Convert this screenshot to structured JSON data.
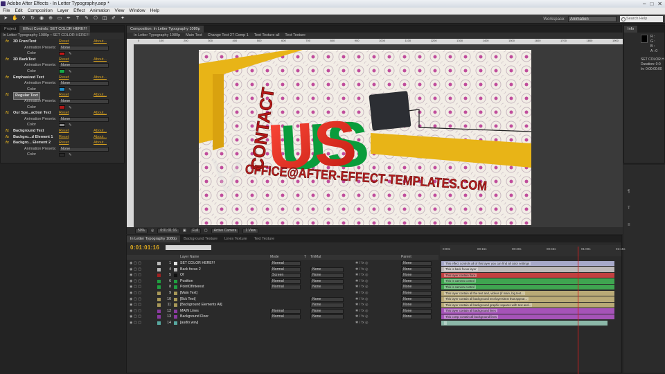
{
  "window": {
    "title": "Adobe After Effects - In Letter Typography.aep *",
    "controls": [
      "–",
      "□",
      "✕"
    ]
  },
  "menu": [
    "File",
    "Edit",
    "Composition",
    "Layer",
    "Effect",
    "Animation",
    "View",
    "Window",
    "Help"
  ],
  "toolbar": {
    "workspace_label": "Workspace:",
    "workspace_value": "Animation",
    "search_placeholder": "Search Help"
  },
  "left_panel": {
    "tabs": [
      "Project",
      "Effect Controls: SET COLOR HERE!!!"
    ],
    "subtitle": "In Letter Typography 1080p • SET COLOR HERE!!!",
    "rows": [
      {
        "kind": "fx",
        "name": "3D FrontText",
        "reset": "Reset",
        "about": "About..."
      },
      {
        "kind": "preset",
        "label": "Animation Presets:",
        "value": "None"
      },
      {
        "kind": "color",
        "label": "Color",
        "color": "#c81818"
      },
      {
        "kind": "fx",
        "name": "3D BackText",
        "reset": "Reset",
        "about": "About..."
      },
      {
        "kind": "preset",
        "label": "Animation Presets:",
        "value": "None"
      },
      {
        "kind": "color",
        "label": "Color",
        "color": "#18a848"
      },
      {
        "kind": "fx",
        "name": "Emphasized Text",
        "reset": "Reset",
        "about": "About..."
      },
      {
        "kind": "preset",
        "label": "Animation Presets:",
        "value": "None"
      },
      {
        "kind": "color",
        "label": "Color",
        "color": "#1e8ec8"
      },
      {
        "kind": "fx",
        "name": "Regular Text",
        "reset": "Reset",
        "about": "About...",
        "selected": true
      },
      {
        "kind": "preset",
        "label": "Animation Presets:",
        "value": "None"
      },
      {
        "kind": "color",
        "label": "Color",
        "color": "#b01818"
      },
      {
        "kind": "fx",
        "name": "Our Spe...action Text",
        "reset": "Reset",
        "about": "About..."
      },
      {
        "kind": "preset",
        "label": "Animation Presets:",
        "value": "None"
      },
      {
        "kind": "color",
        "label": "Color",
        "color": "#888888"
      },
      {
        "kind": "fx",
        "name": "Background Text",
        "reset": "Reset",
        "about": "About..."
      },
      {
        "kind": "fx",
        "name": "Backgro...d Element 1",
        "reset": "Reset",
        "about": "About..."
      },
      {
        "kind": "fx",
        "name": "Backgro... Element 2",
        "reset": "Reset",
        "about": "About..."
      },
      {
        "kind": "preset",
        "label": "Animation Presets:",
        "value": "None"
      },
      {
        "kind": "color",
        "label": "Color",
        "color": "#2a2a2a"
      }
    ]
  },
  "composition": {
    "tab": "Composition: In Letter Typography 1080p",
    "breadcrumbs": [
      "In Letter Typography 1080p",
      "Main Text",
      "Change Text 27 Comp 1",
      "Text Texture all",
      "Text Texture"
    ],
    "ruler_ticks": [
      "0",
      "100",
      "200",
      "300",
      "400",
      "500",
      "600",
      "700",
      "800",
      "900",
      "1000",
      "1100",
      "1200",
      "1300",
      "1400",
      "1500",
      "1600",
      "1700",
      "1800",
      "1900"
    ],
    "bottom": {
      "zoom": "50%",
      "timecode": "0:01:01:16",
      "resolution": "Full",
      "camera": "Active Camera",
      "views": "1 View"
    },
    "artwork": {
      "contact": "CONTACT",
      "us": "US",
      "email": "OFFICE@AFTER-EFFECT-TEMPLATES.COM",
      "watermark": "V"
    }
  },
  "info": {
    "tab": "Info",
    "r": "R :",
    "g": "G :",
    "b": "B :",
    "a": "A : 0",
    "line1": "SET COLOR H",
    "line2": "Duration: 0:0",
    "line3": "In: 0:00:00:00"
  },
  "timeline": {
    "tabs": [
      "In Letter Typography 1080p",
      "Background Texture",
      "Lines Texture",
      "Text Texture"
    ],
    "timecode": "0:01:01:16",
    "columns": {
      "name": "Layer Name",
      "mode": "Mode",
      "t": "T",
      "trkmat": "TrkMat",
      "parent": "Parent"
    },
    "ruler": [
      "0:00s",
      "00:15s",
      "00:30s",
      "00:45s",
      "01:00s",
      "01:15s"
    ],
    "layers": [
      {
        "num": "1",
        "name": "SET COLOR HERE!!!",
        "label": "#b8b8b8",
        "mode": "Normal",
        "trk": "",
        "parent": "None",
        "bar_color": "#a7a9c9",
        "bar_text": "This effect controls all of this layer you can find all color settings"
      },
      {
        "num": "4",
        "name": "Back focus 2",
        "label": "#b8b8b8",
        "mode": "Normal",
        "trk": "None",
        "parent": "None",
        "bar_color": "#bdb8b8",
        "bar_text": "This is back focus layer"
      },
      {
        "num": "5",
        "name": "Of",
        "label": "#a02020",
        "mode": "Screen",
        "trk": "None",
        "parent": "None",
        "bar_color": "#c14040",
        "bar_text": "This layer contain flare"
      },
      {
        "num": "6",
        "name": "Position",
        "label": "#20a040",
        "mode": "Normal",
        "trk": "None",
        "parent": "None",
        "bar_color": "#3fa550",
        "bar_text": "This is camera control"
      },
      {
        "num": "8",
        "name": "PointOfInterest",
        "label": "#20a040",
        "mode": "Normal",
        "trk": "None",
        "parent": "None",
        "bar_color": "#3fa550",
        "bar_text": "This is camera control"
      },
      {
        "num": "9",
        "name": "[Main Text]",
        "label": "#a89858",
        "mode": "",
        "trk": "",
        "parent": "None",
        "bar_color": "#b9aa76",
        "bar_text": "This layer contain all the text and, videos (if main, big text..."
      },
      {
        "num": "10",
        "name": "[Bck Text]",
        "label": "#a89858",
        "mode": "",
        "trk": "None",
        "parent": "None",
        "bar_color": "#b9aa76",
        "bar_text": "This layer contain all background text layers/text that appear..."
      },
      {
        "num": "11",
        "name": "[Background Elements All]",
        "label": "#a89858",
        "mode": "",
        "trk": "None",
        "parent": "None",
        "bar_color": "#b9aa76",
        "bar_text": "This layer contain all background graphic squares with text and..."
      },
      {
        "num": "12",
        "name": "MAIN Lines",
        "label": "#8a3aa0",
        "mode": "Normal",
        "trk": "None",
        "parent": "None",
        "bar_color": "#a553b8",
        "bar_text": "This layer contain all background lines"
      },
      {
        "num": "13",
        "name": "Background Floor",
        "label": "#8a3aa0",
        "mode": "Normal",
        "trk": "None",
        "parent": "None",
        "bar_color": "#a553b8",
        "bar_text": "This comp contain all background lines"
      },
      {
        "num": "14",
        "name": "[audio.wav]",
        "label": "#58a8a0",
        "mode": "",
        "trk": "",
        "parent": "",
        "bar_color": "#8cb8a8",
        "bar_text": ""
      }
    ]
  }
}
